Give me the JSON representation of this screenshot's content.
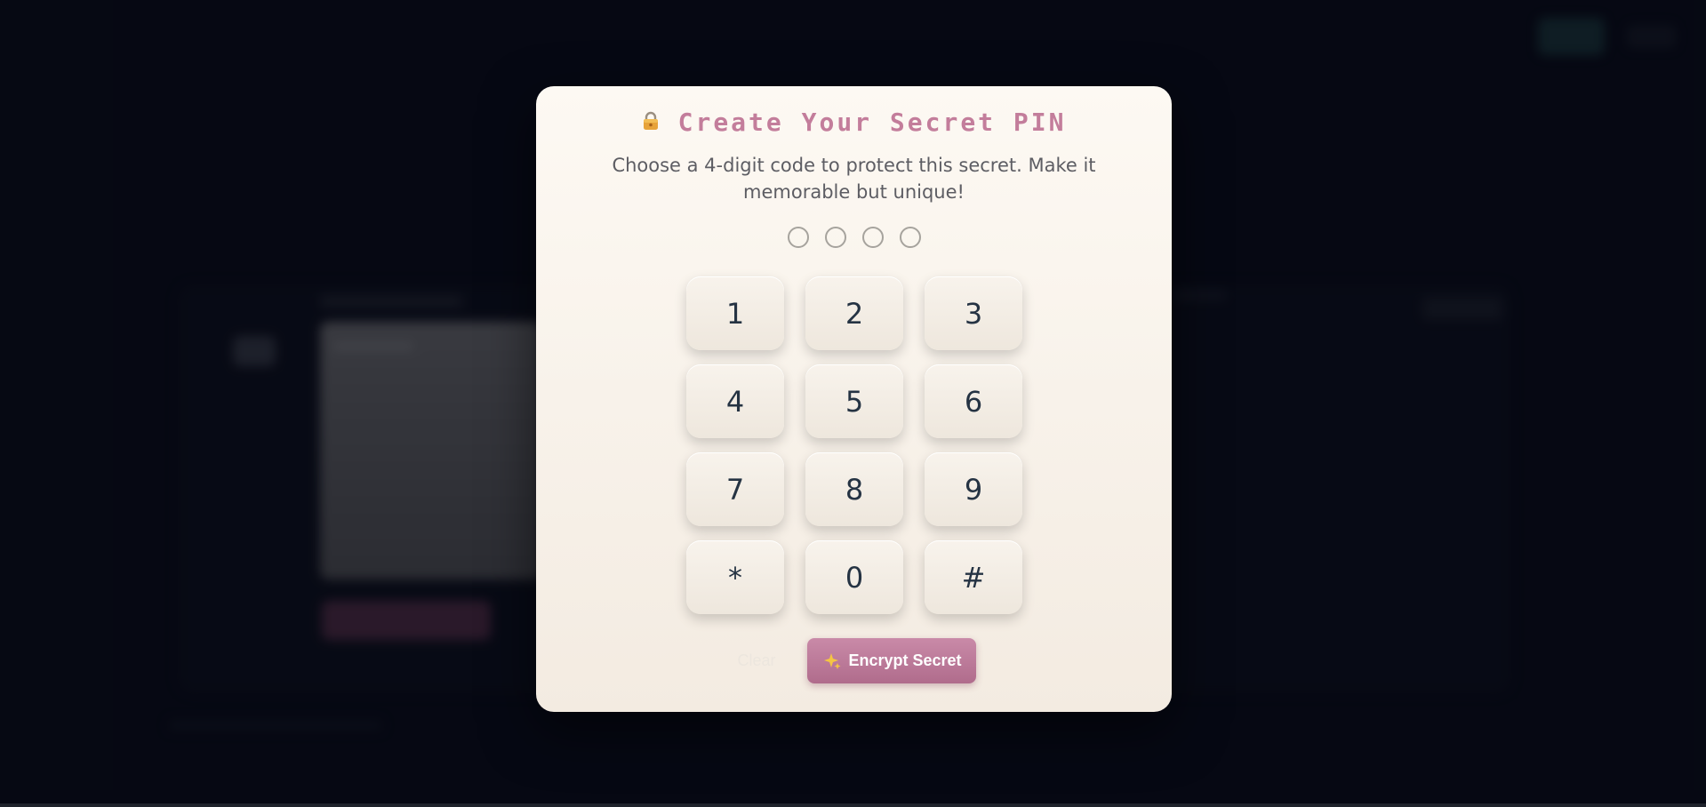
{
  "modal": {
    "title": "Create Your Secret PIN",
    "subtitle": "Choose a 4-digit code to protect this secret. Make it memorable but unique!",
    "pin_length": 4,
    "pin_filled": 0,
    "keys": [
      "1",
      "2",
      "3",
      "4",
      "5",
      "6",
      "7",
      "8",
      "9",
      "*",
      "0",
      "#"
    ],
    "clear_label": "Clear",
    "encrypt_label": "Encrypt Secret"
  },
  "icons": {
    "title_icon": "lock-icon",
    "encrypt_icon": "sparkle-icon"
  },
  "colors": {
    "accent": "#c37d9b",
    "button": "#b87896",
    "key_text": "#253343",
    "modal_bg": "#fbf5ee",
    "page_bg": "#070a14"
  }
}
